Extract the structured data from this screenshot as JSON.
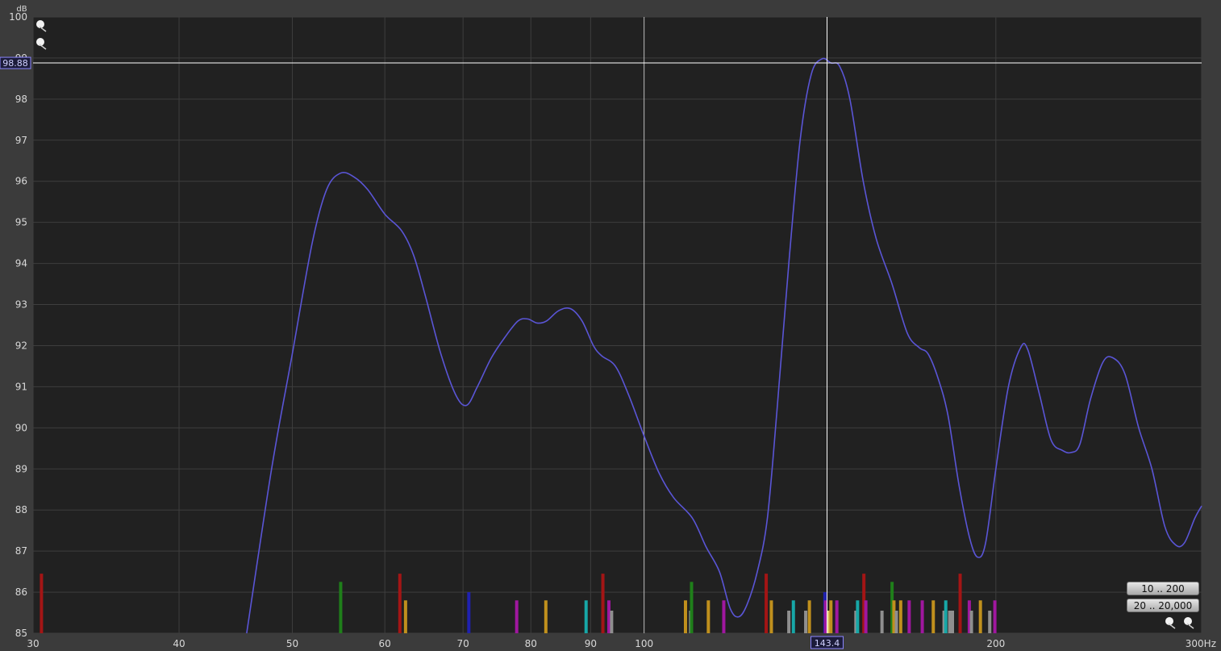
{
  "axes": {
    "y_unit": "dB",
    "x_unit": "Hz",
    "y_tick_labels": [
      "100",
      "99",
      "98",
      "97",
      "96",
      "95",
      "94",
      "93",
      "92",
      "91",
      "90",
      "89",
      "88",
      "87",
      "86",
      "85"
    ],
    "x_tick_labels": [
      "30",
      "40",
      "50",
      "60",
      "70",
      "80",
      "90",
      "100",
      "200",
      "300Hz"
    ]
  },
  "cursor": {
    "level_db": "98.88",
    "freq_hz": "143.4"
  },
  "buttons": {
    "range_low": "10 .. 200",
    "range_full": "20 .. 20,000"
  },
  "icons": {
    "zoom_in_top": "magnifier-plus-icon",
    "zoom_out_top": "magnifier-minus-icon",
    "zoom_out_bottom": "magnifier-minus-icon",
    "zoom_in_bottom": "magnifier-plus-icon"
  },
  "colors": {
    "background": "#212121",
    "grid": "#3e3e3e",
    "curve": "#5a55d6",
    "cursor": "#ffffff"
  },
  "chart_data": {
    "type": "line",
    "x_scale": "log",
    "xlim": [
      30,
      300
    ],
    "ylim": [
      85,
      100
    ],
    "x_ticks": [
      30,
      40,
      50,
      60,
      70,
      80,
      90,
      100,
      200,
      300
    ],
    "y_ticks": [
      100,
      99,
      98,
      97,
      96,
      95,
      94,
      93,
      92,
      91,
      90,
      89,
      88,
      87,
      86,
      85
    ],
    "grid": true,
    "cursor": {
      "x": 143.4,
      "y": 98.88
    },
    "series": [
      {
        "color": "#5a55d6",
        "points": [
          [
            45.7,
            85.0
          ],
          [
            48.0,
            89.0
          ],
          [
            50.0,
            91.8
          ],
          [
            52.0,
            94.5
          ],
          [
            53.5,
            95.8
          ],
          [
            55.0,
            96.2
          ],
          [
            56.5,
            96.1
          ],
          [
            58.0,
            95.8
          ],
          [
            60.0,
            95.2
          ],
          [
            62.0,
            94.8
          ],
          [
            63.5,
            94.2
          ],
          [
            65.0,
            93.2
          ],
          [
            67.0,
            91.8
          ],
          [
            69.0,
            90.8
          ],
          [
            70.5,
            90.55
          ],
          [
            72.0,
            91.0
          ],
          [
            74.0,
            91.7
          ],
          [
            76.0,
            92.2
          ],
          [
            78.0,
            92.6
          ],
          [
            79.5,
            92.65
          ],
          [
            81.0,
            92.55
          ],
          [
            82.5,
            92.6
          ],
          [
            84.5,
            92.85
          ],
          [
            86.5,
            92.9
          ],
          [
            88.5,
            92.6
          ],
          [
            90.5,
            92.0
          ],
          [
            92.0,
            91.75
          ],
          [
            94.5,
            91.5
          ],
          [
            97.0,
            90.8
          ],
          [
            100.0,
            89.8
          ],
          [
            103.0,
            88.9
          ],
          [
            106.0,
            88.3
          ],
          [
            110.0,
            87.8
          ],
          [
            113.0,
            87.1
          ],
          [
            116.0,
            86.5
          ],
          [
            118.5,
            85.6
          ],
          [
            120.5,
            85.4
          ],
          [
            122.5,
            85.7
          ],
          [
            125.0,
            86.5
          ],
          [
            127.5,
            87.8
          ],
          [
            130.0,
            90.5
          ],
          [
            133.0,
            94.0
          ],
          [
            136.0,
            97.0
          ],
          [
            139.0,
            98.6
          ],
          [
            142.0,
            98.98
          ],
          [
            144.5,
            98.88
          ],
          [
            147.0,
            98.8
          ],
          [
            150.0,
            98.0
          ],
          [
            154.0,
            96.0
          ],
          [
            158.0,
            94.6
          ],
          [
            163.0,
            93.5
          ],
          [
            168.0,
            92.3
          ],
          [
            172.0,
            91.95
          ],
          [
            175.0,
            91.8
          ],
          [
            178.5,
            91.2
          ],
          [
            182.0,
            90.3
          ],
          [
            186.0,
            88.6
          ],
          [
            190.0,
            87.3
          ],
          [
            193.0,
            86.85
          ],
          [
            196.0,
            87.2
          ],
          [
            200.0,
            89.0
          ],
          [
            205.0,
            91.0
          ],
          [
            210.0,
            91.95
          ],
          [
            213.0,
            91.9
          ],
          [
            218.0,
            90.8
          ],
          [
            223.0,
            89.7
          ],
          [
            228.0,
            89.45
          ],
          [
            232.0,
            89.4
          ],
          [
            236.0,
            89.6
          ],
          [
            241.0,
            90.7
          ],
          [
            247.0,
            91.6
          ],
          [
            252.0,
            91.7
          ],
          [
            258.0,
            91.3
          ],
          [
            265.0,
            90.0
          ],
          [
            272.0,
            89.0
          ],
          [
            279.0,
            87.6
          ],
          [
            285.0,
            87.15
          ],
          [
            290.0,
            87.2
          ],
          [
            296.0,
            87.8
          ],
          [
            300.0,
            88.1
          ]
        ]
      }
    ],
    "markers": [
      {
        "x": 30.5,
        "h": 1.45,
        "color": "#a31515"
      },
      {
        "x": 55.0,
        "h": 1.25,
        "color": "#1f7f1a"
      },
      {
        "x": 61.8,
        "h": 1.45,
        "color": "#a31515"
      },
      {
        "x": 62.5,
        "h": 0.8,
        "color": "#c0901d"
      },
      {
        "x": 70.8,
        "h": 1.0,
        "color": "#1f21b0"
      },
      {
        "x": 77.8,
        "h": 0.8,
        "color": "#a0179f"
      },
      {
        "x": 82.4,
        "h": 0.8,
        "color": "#c0901d"
      },
      {
        "x": 89.2,
        "h": 0.8,
        "color": "#17a7a7"
      },
      {
        "x": 92.2,
        "h": 1.45,
        "color": "#a31515"
      },
      {
        "x": 93.3,
        "h": 0.8,
        "color": "#a0179f"
      },
      {
        "x": 93.8,
        "h": 0.55,
        "color": "#8f8f8f"
      },
      {
        "x": 108.5,
        "h": 0.8,
        "color": "#c0901d"
      },
      {
        "x": 109.6,
        "h": 0.55,
        "color": "#8f8f8f"
      },
      {
        "x": 109.8,
        "h": 1.25,
        "color": "#1f7f1a"
      },
      {
        "x": 113.5,
        "h": 0.8,
        "color": "#c0901d"
      },
      {
        "x": 117.0,
        "h": 0.8,
        "color": "#a0179f"
      },
      {
        "x": 127.2,
        "h": 1.45,
        "color": "#a31515"
      },
      {
        "x": 128.5,
        "h": 0.8,
        "color": "#c0901d"
      },
      {
        "x": 133.0,
        "h": 0.55,
        "color": "#8f8f8f"
      },
      {
        "x": 134.2,
        "h": 0.8,
        "color": "#17a7a7"
      },
      {
        "x": 137.5,
        "h": 0.55,
        "color": "#8f8f8f"
      },
      {
        "x": 138.5,
        "h": 0.8,
        "color": "#c0901d"
      },
      {
        "x": 142.8,
        "h": 1.0,
        "color": "#1f21b0"
      },
      {
        "x": 143.0,
        "h": 0.8,
        "color": "#a0179f"
      },
      {
        "x": 143.8,
        "h": 0.55,
        "color": "#e0c870"
      },
      {
        "x": 144.5,
        "h": 0.8,
        "color": "#c0901d"
      },
      {
        "x": 146.2,
        "h": 0.8,
        "color": "#a0179f"
      },
      {
        "x": 151.8,
        "h": 0.55,
        "color": "#8f8f8f"
      },
      {
        "x": 152.3,
        "h": 0.8,
        "color": "#17a7a7"
      },
      {
        "x": 154.2,
        "h": 1.45,
        "color": "#a31515"
      },
      {
        "x": 154.8,
        "h": 0.8,
        "color": "#a0179f"
      },
      {
        "x": 159.8,
        "h": 0.55,
        "color": "#8f8f8f"
      },
      {
        "x": 163.0,
        "h": 1.25,
        "color": "#1f7f1a"
      },
      {
        "x": 163.6,
        "h": 0.8,
        "color": "#c0901d"
      },
      {
        "x": 164.4,
        "h": 0.55,
        "color": "#8f8f8f"
      },
      {
        "x": 165.8,
        "h": 0.8,
        "color": "#c0901d"
      },
      {
        "x": 168.6,
        "h": 0.8,
        "color": "#a0179f"
      },
      {
        "x": 173.0,
        "h": 0.8,
        "color": "#a0179f"
      },
      {
        "x": 176.8,
        "h": 0.8,
        "color": "#c0901d"
      },
      {
        "x": 180.6,
        "h": 0.55,
        "color": "#8f8f8f"
      },
      {
        "x": 181.2,
        "h": 0.8,
        "color": "#17a7a7"
      },
      {
        "x": 182.6,
        "h": 0.55,
        "color": "#8f8f8f"
      },
      {
        "x": 183.6,
        "h": 0.55,
        "color": "#8f8f8f"
      },
      {
        "x": 186.4,
        "h": 1.45,
        "color": "#a31515"
      },
      {
        "x": 189.8,
        "h": 0.8,
        "color": "#a0179f"
      },
      {
        "x": 190.6,
        "h": 0.55,
        "color": "#8f8f8f"
      },
      {
        "x": 194.0,
        "h": 0.8,
        "color": "#c0901d"
      },
      {
        "x": 197.6,
        "h": 0.55,
        "color": "#8f8f8f"
      },
      {
        "x": 199.6,
        "h": 0.8,
        "color": "#a0179f"
      }
    ]
  }
}
